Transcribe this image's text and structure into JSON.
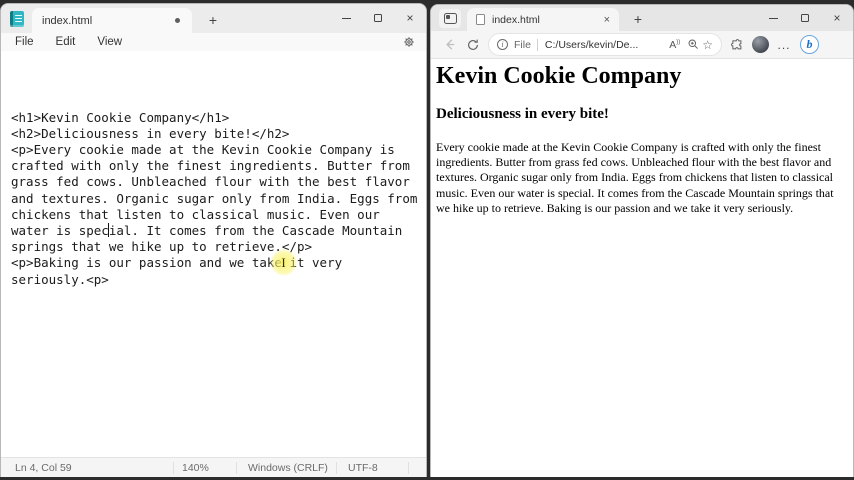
{
  "notepad": {
    "tab_title": "index.html",
    "menu": [
      "File",
      "Edit",
      "View"
    ],
    "code_lines": [
      "<h1>Kevin Cookie Company</h1>",
      "<h2>Deliciousness in every bite!</h2>",
      "<p>Every cookie made at the Kevin Cookie Company is",
      "crafted with only the finest ingredients. Butter from",
      "grass fed cows. Unbleached flour with the best flavor",
      "and textures. Organic sugar only from India. Eggs from",
      "chickens that listen to classical music. Even our",
      "water is special. It comes from the Cascade Mountain",
      "springs that we hike up to retrieve.</p>",
      "<p>Baking is our passion and we take it very",
      "seriously.<p>"
    ],
    "status": {
      "position": "Ln 4, Col 59",
      "zoom": "140%",
      "line_ending": "Windows (CRLF)",
      "encoding": "UTF-8"
    }
  },
  "edge": {
    "tab_title": "index.html",
    "address": {
      "badge": "File",
      "url": "C:/Users/kevin/De..."
    },
    "page": {
      "heading": "Kevin Cookie Company",
      "subheading": "Deliciousness in every bite!",
      "body_text": "Every cookie made at the Kevin Cookie Company is crafted with only the finest ingredients. Butter from grass fed cows. Unbleached flour with the best flavor and textures. Organic sugar only from India. Eggs from chickens that listen to classical music. Even our water is special. It comes from the Cascade Mountain springs that we hike up to retrieve. Baking is our passion and we take it very seriously."
    }
  },
  "icons": {
    "close": "×",
    "new_tab": "+",
    "ellipsis": "...",
    "star": "☆",
    "read_aloud": "A",
    "read_aloud_waves": "))",
    "info": "i",
    "bing": "b",
    "ibeam": "I"
  }
}
